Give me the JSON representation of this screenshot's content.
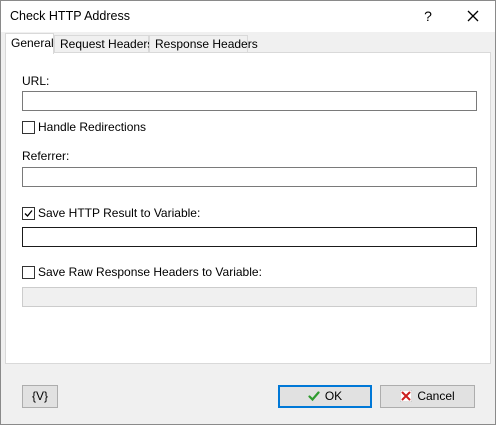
{
  "window": {
    "title": "Check HTTP Address",
    "help_label": "?"
  },
  "tabs": [
    {
      "label": "General",
      "active": true
    },
    {
      "label": "Request Headers",
      "active": false
    },
    {
      "label": "Response Headers",
      "active": false
    }
  ],
  "general": {
    "url_label": "URL:",
    "url_value": "",
    "handle_redirections_label": "Handle Redirections",
    "handle_redirections_checked": false,
    "referrer_label": "Referrer:",
    "referrer_value": "",
    "save_result_label": "Save HTTP Result to Variable:",
    "save_result_checked": true,
    "save_result_value": "",
    "save_headers_label": "Save Raw Response Headers to Variable:",
    "save_headers_checked": false,
    "save_headers_value": ""
  },
  "footer": {
    "variables_label": "{V}",
    "ok_label": "OK",
    "cancel_label": "Cancel"
  },
  "colors": {
    "ok_check": "#2e9b2e",
    "cancel_x": "#cc1f1f",
    "focus_border": "#0078d7"
  },
  "icons": [
    "close-icon",
    "checkmark-icon",
    "ok-check-icon",
    "cancel-x-icon"
  ]
}
